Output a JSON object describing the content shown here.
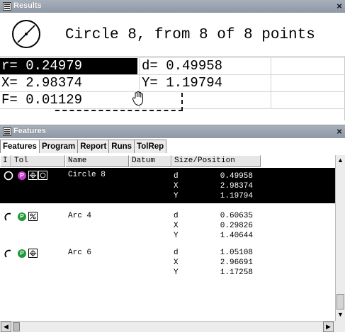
{
  "results": {
    "title": "Results",
    "close": "×",
    "headline": "Circle 8, from 8 of 8 points",
    "r": "r= 0.24979",
    "d": "d= 0.49958",
    "x": "X= 2.98374",
    "y": "Y= 1.19794",
    "f": "F= 0.01129"
  },
  "features": {
    "title": "Features",
    "close": "×",
    "tabs": [
      "Features",
      "Program",
      "Report",
      "Runs",
      "TolRep"
    ],
    "active_tab": "Features",
    "columns": [
      "I",
      "Tol",
      "Name",
      "Datum",
      "Size/Position"
    ],
    "items": [
      {
        "name": "Circle 8",
        "selected": true,
        "indicator": "circle-indicator-icon",
        "badge": "P",
        "badge_color": "#c83ec8",
        "tol_icons": [
          "position-tolerance-icon",
          "circularity-tolerance-icon"
        ],
        "rows": [
          {
            "label": "d",
            "value": "0.49958"
          },
          {
            "label": "X",
            "value": "2.98374"
          },
          {
            "label": "Y",
            "value": "1.19794"
          }
        ]
      },
      {
        "name": "Arc 4",
        "selected": false,
        "indicator": "arc-indicator-icon",
        "badge": "P",
        "badge_color": "#1f9a3a",
        "tol_icons": [
          "profile-tolerance-icon"
        ],
        "rows": [
          {
            "label": "d",
            "value": "0.60635"
          },
          {
            "label": "X",
            "value": "0.29826"
          },
          {
            "label": "Y",
            "value": "1.40644"
          }
        ]
      },
      {
        "name": "Arc 6",
        "selected": false,
        "indicator": "arc-indicator-icon",
        "badge": "P",
        "badge_color": "#1f9a3a",
        "tol_icons": [
          "position-tolerance-icon"
        ],
        "rows": [
          {
            "label": "d",
            "value": "1.05108"
          },
          {
            "label": "X",
            "value": "2.96691"
          },
          {
            "label": "Y",
            "value": "1.17258"
          }
        ]
      }
    ],
    "scroll_up": "▲",
    "scroll_down": "▼",
    "scroll_left": "◀",
    "scroll_right": "▶"
  }
}
